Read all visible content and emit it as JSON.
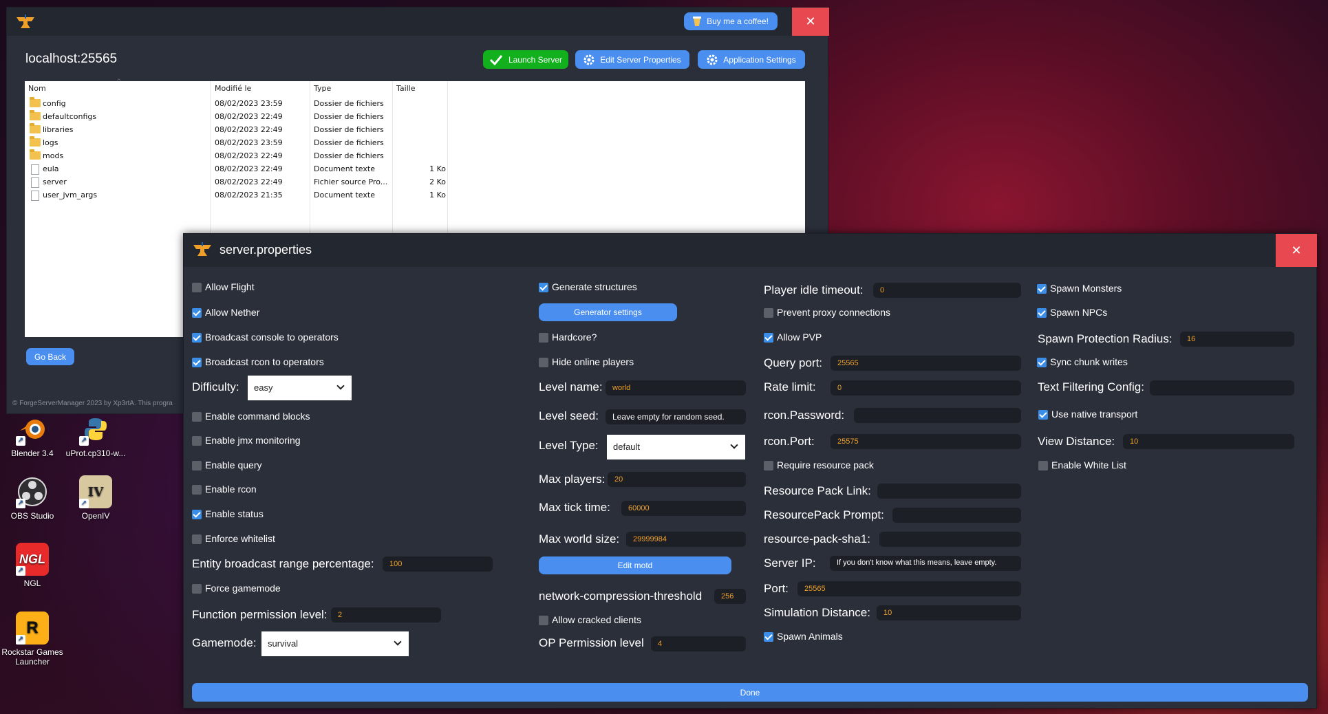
{
  "desktop": {
    "icons": [
      {
        "label": "Blender 3.4",
        "icon": "blender-icon",
        "color": "#e87d0d"
      },
      {
        "label": "uProt.cp310-w...",
        "icon": "python-file-icon",
        "color": "#3776ab"
      },
      {
        "label": "OBS Studio",
        "icon": "obs-icon",
        "color": "#302e31"
      },
      {
        "label": "OpenIV",
        "icon": "openiv-icon",
        "color": "#d8c8a0"
      },
      {
        "label": "NGL",
        "icon": "ngl-icon",
        "color": "#e82a2a",
        "text": "NGL"
      },
      {
        "label": "Rockstar Games Launcher",
        "icon": "rockstar-icon",
        "color": "#fcaf17",
        "text": "R"
      }
    ]
  },
  "main_window": {
    "donate_label": "Buy me a coffee!",
    "server_title": "localhost:25565",
    "toolbar": {
      "launch_label": "Launch Server",
      "edit_props_label": "Edit Server Properties",
      "app_settings_label": "Application Settings"
    },
    "file_list": {
      "columns": [
        "Nom",
        "Modifié le",
        "Type",
        "Taille"
      ],
      "rows": [
        {
          "name": "config",
          "modified": "08/02/2023 23:59",
          "type": "Dossier de fichiers",
          "size": "",
          "kind": "folder"
        },
        {
          "name": "defaultconfigs",
          "modified": "08/02/2023 22:49",
          "type": "Dossier de fichiers",
          "size": "",
          "kind": "folder"
        },
        {
          "name": "libraries",
          "modified": "08/02/2023 22:49",
          "type": "Dossier de fichiers",
          "size": "",
          "kind": "folder"
        },
        {
          "name": "logs",
          "modified": "08/02/2023 23:59",
          "type": "Dossier de fichiers",
          "size": "",
          "kind": "folder"
        },
        {
          "name": "mods",
          "modified": "08/02/2023 22:49",
          "type": "Dossier de fichiers",
          "size": "",
          "kind": "folder"
        },
        {
          "name": "eula",
          "modified": "08/02/2023 22:49",
          "type": "Document texte",
          "size": "1 Ko",
          "kind": "file"
        },
        {
          "name": "server",
          "modified": "08/02/2023 22:49",
          "type": "Fichier source Pro...",
          "size": "2 Ko",
          "kind": "file"
        },
        {
          "name": "user_jvm_args",
          "modified": "08/02/2023 21:35",
          "type": "Document texte",
          "size": "1 Ko",
          "kind": "file"
        }
      ]
    },
    "go_back_label": "Go Back",
    "footer": "© ForgeServerManager 2023 by Xp3rtA. This progra"
  },
  "props": {
    "title": "server.properties",
    "col1": {
      "allow_flight": {
        "label": "Allow Flight",
        "checked": false
      },
      "allow_nether": {
        "label": "Allow Nether",
        "checked": true
      },
      "broadcast_console": {
        "label": "Broadcast console to operators",
        "checked": true
      },
      "broadcast_rcon": {
        "label": "Broadcast rcon to operators",
        "checked": true
      },
      "difficulty_label": "Difficulty:",
      "difficulty_value": "easy",
      "enable_command_blocks": {
        "label": "Enable command blocks",
        "checked": false
      },
      "enable_jmx": {
        "label": "Enable jmx monitoring",
        "checked": false
      },
      "enable_query": {
        "label": "Enable query",
        "checked": false
      },
      "enable_rcon": {
        "label": "Enable rcon",
        "checked": false
      },
      "enable_status": {
        "label": "Enable status",
        "checked": true
      },
      "enforce_whitelist": {
        "label": "Enforce whitelist",
        "checked": false
      },
      "entity_broadcast_label": "Entity broadcast range percentage:",
      "entity_broadcast_value": "100",
      "force_gamemode": {
        "label": "Force gamemode",
        "checked": false
      },
      "function_permission_label": "Function permission level:",
      "function_permission_value": "2",
      "gamemode_label": "Gamemode:",
      "gamemode_value": "survival"
    },
    "col2": {
      "generate_structures": {
        "label": "Generate structures",
        "checked": true
      },
      "generator_settings_label": "Generator settings",
      "hardcore": {
        "label": "Hardcore?",
        "checked": false
      },
      "hide_online_players": {
        "label": "Hide online players",
        "checked": false
      },
      "level_name_label": "Level name:",
      "level_name_value": "world",
      "level_seed_label": "Level seed:",
      "level_seed_placeholder": "Leave empty for random seed.",
      "level_type_label": "Level Type:",
      "level_type_value": "default",
      "max_players_label": "Max players:",
      "max_players_value": "20",
      "max_tick_label": "Max tick time:",
      "max_tick_value": "60000",
      "max_world_label": "Max world size:",
      "max_world_value": "29999984",
      "edit_motd_label": "Edit motd",
      "net_compression_label": "network-compression-threshold",
      "net_compression_value": "256",
      "allow_cracked": {
        "label": "Allow cracked clients",
        "checked": false
      },
      "op_permission_label": "OP Permission level",
      "op_permission_value": "4"
    },
    "col3": {
      "player_idle_label": "Player idle timeout:",
      "player_idle_value": "0",
      "prevent_proxy": {
        "label": "Prevent proxy connections",
        "checked": false
      },
      "allow_pvp": {
        "label": "Allow PVP",
        "checked": true
      },
      "query_port_label": "Query port:",
      "query_port_value": "25565",
      "rate_limit_label": "Rate limit:",
      "rate_limit_value": "0",
      "rcon_password_label": "rcon.Password:",
      "rcon_password_value": "",
      "rcon_port_label": "rcon.Port:",
      "rcon_port_value": "25575",
      "require_resource_pack": {
        "label": "Require resource pack",
        "checked": false
      },
      "resource_pack_link_label": "Resource Pack Link:",
      "resource_pack_link_value": "",
      "resource_pack_prompt_label": "ResourcePack Prompt:",
      "resource_pack_prompt_value": "",
      "resource_pack_sha1_label": "resource-pack-sha1:",
      "resource_pack_sha1_value": "",
      "server_ip_label": "Server IP:",
      "server_ip_placeholder": "If you don't know what this means, leave empty.",
      "port_label": "Port:",
      "port_value": "25565",
      "simulation_distance_label": "Simulation Distance:",
      "simulation_distance_value": "10",
      "spawn_animals": {
        "label": "Spawn Animals",
        "checked": true
      }
    },
    "col4": {
      "spawn_monsters": {
        "label": "Spawn Monsters",
        "checked": true
      },
      "spawn_npcs": {
        "label": "Spawn NPCs",
        "checked": true
      },
      "spawn_protection_label": "Spawn Protection Radius:",
      "spawn_protection_value": "16",
      "sync_chunk_writes": {
        "label": "Sync chunk writes",
        "checked": true
      },
      "text_filtering_label": "Text Filtering Config:",
      "text_filtering_value": "",
      "use_native_transport": {
        "label": "Use native transport",
        "checked": true
      },
      "view_distance_label": "View Distance:",
      "view_distance_value": "10",
      "enable_white_list": {
        "label": "Enable White List",
        "checked": false
      }
    },
    "done_label": "Done"
  },
  "colors": {
    "accent_blue": "#4a8ff0",
    "launch_green": "#13b01e",
    "close_red": "#e8484f",
    "window_bg": "#2b2f3a",
    "field_value": "#f0a028"
  }
}
